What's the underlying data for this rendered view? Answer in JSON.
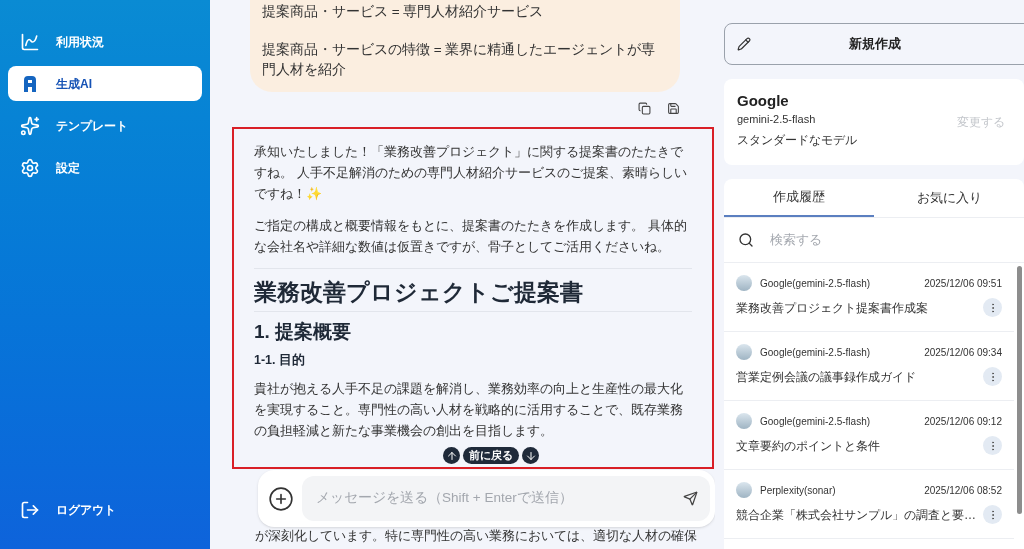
{
  "sidebar": {
    "items": [
      {
        "label": "利用状況",
        "selected": false
      },
      {
        "label": "生成AI",
        "selected": true
      },
      {
        "label": "テンプレート",
        "selected": false
      },
      {
        "label": "設定",
        "selected": false
      }
    ],
    "logout": "ログアウト"
  },
  "chat": {
    "user_message": [
      "提案商品・サービス = 専門人材紹介サービス",
      "提案商品・サービスの特徴 = 業界に精通したエージェントが専門人材を紹介"
    ],
    "response": {
      "blocks": [
        {
          "kind": "paragraph",
          "text": "承知いたしました！「業務改善プロジェクト」に関する提案書のたたきですね。 人手不足解消のための専門人材紹介サービスのご提案、素晴らしいですね！✨"
        },
        {
          "kind": "paragraph",
          "text": "ご指定の構成と概要情報をもとに、提案書のたたきを作成します。 具体的な会社名や詳細な数値は仮置きですが、骨子としてご活用くださいね。"
        },
        {
          "kind": "rule"
        },
        {
          "kind": "h1",
          "text": "業務改善プロジェクトご提案書"
        },
        {
          "kind": "h2",
          "text": "1. 提案概要"
        },
        {
          "kind": "h3",
          "text": "1-1. 目的"
        },
        {
          "kind": "paragraph",
          "text": "貴社が抱える人手不足の課題を解消し、業務効率の向上と生産性の最大化を実現すること。専門性の高い人材を戦略的に活用することで、既存業務の負担軽減と新たな事業機会の創出を目指します。"
        }
      ]
    },
    "jump": {
      "label": "前に戻る"
    },
    "trailing_text": "が深刻化しています。特に専門性の高い業務においては、適切な人材の確保",
    "input": {
      "placeholder": "メッセージを送る（Shift + Enterで送信）"
    }
  },
  "right_panel": {
    "new_button": "新規作成",
    "model": {
      "provider": "Google",
      "name": "gemini-2.5-flash",
      "description": "スタンダードなモデル",
      "change": "変更する"
    },
    "tabs": [
      {
        "label": "作成履歴",
        "selected": true
      },
      {
        "label": "お気に入り",
        "selected": false
      }
    ],
    "search": {
      "placeholder": "検索する"
    },
    "history": [
      {
        "model": "Google(gemini-2.5-flash)",
        "time": "2025/12/06 09:51",
        "title": "業務改善プロジェクト提案書作成案"
      },
      {
        "model": "Google(gemini-2.5-flash)",
        "time": "2025/12/06 09:34",
        "title": "営業定例会議の議事録作成ガイド"
      },
      {
        "model": "Google(gemini-2.5-flash)",
        "time": "2025/12/06 09:12",
        "title": "文章要約のポイントと条件"
      },
      {
        "model": "Perplexity(sonar)",
        "time": "2025/12/06 08:52",
        "title": "競合企業「株式会社サンプル」の調査と要…"
      }
    ]
  }
}
